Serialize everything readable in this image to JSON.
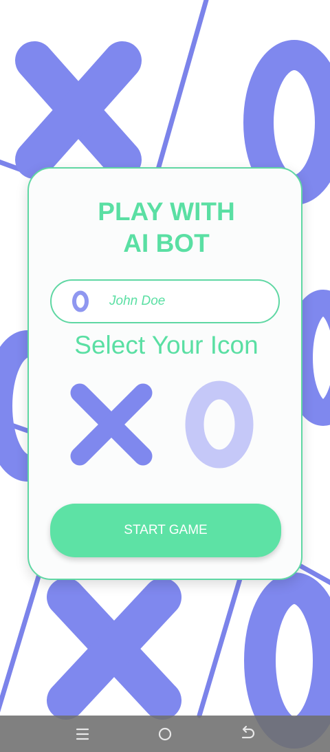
{
  "screen": {
    "title_line1": "PLAY WITH",
    "title_line2": "AI BOT",
    "player_name": "John Doe",
    "select_label": "Select Your Icon",
    "start_label": "START GAME"
  },
  "icons": {
    "player_avatar": "o-icon",
    "choice_x": "x-icon",
    "choice_o": "o-icon",
    "nav_menu": "menu-icon",
    "nav_home": "home-icon",
    "nav_back": "back-icon"
  },
  "colors": {
    "accent_green": "#5adfa3",
    "button_green": "#5de2a5",
    "piece_blue": "#7f88ee",
    "piece_light": "#c5c8f8"
  }
}
